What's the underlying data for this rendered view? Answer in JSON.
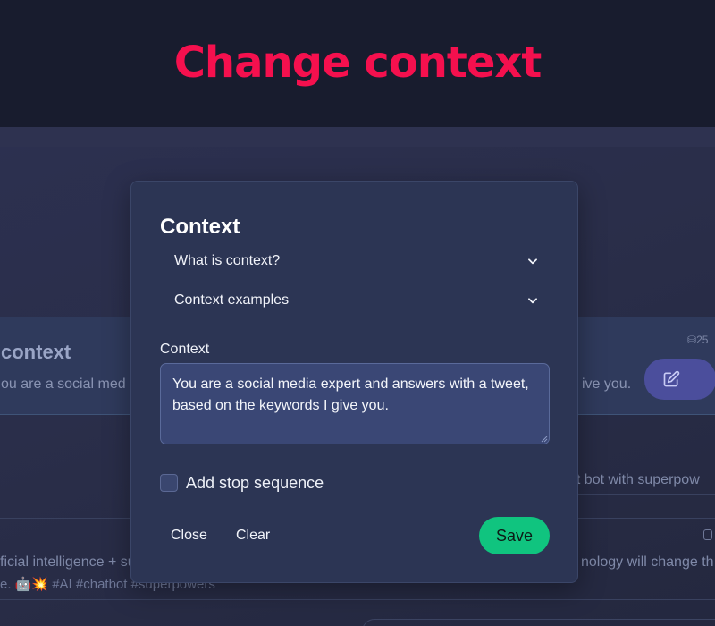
{
  "header": {
    "title": "Change context"
  },
  "background": {
    "card1": {
      "title": "context",
      "text_left": "ou are a social med",
      "text_right": "ive you.",
      "count": "25"
    },
    "card2": {
      "text": "at bot with superpow"
    },
    "card3": {
      "text_line1": "ficial intelligence + su",
      "text_line2": "e. 🤖💥 #AI #chatbot #superpowers",
      "text_right": "nology will change th"
    }
  },
  "modal": {
    "title": "Context",
    "accordions": [
      {
        "label": "What is context?",
        "icon": "chevron-down-icon"
      },
      {
        "label": "Context examples",
        "icon": "chevron-down-icon"
      }
    ],
    "context_field": {
      "label": "Context",
      "value": "You are a social media expert and answers with a tweet, based on the keywords I give you."
    },
    "stop_sequence": {
      "label": "Add stop sequence",
      "checked": false
    },
    "buttons": {
      "close": "Close",
      "clear": "Clear",
      "save": "Save"
    }
  },
  "colors": {
    "title_accent": "#f5104e",
    "save_button": "#10c47f",
    "modal_bg": "#2c3554",
    "page_bg": "#1a1f33"
  }
}
